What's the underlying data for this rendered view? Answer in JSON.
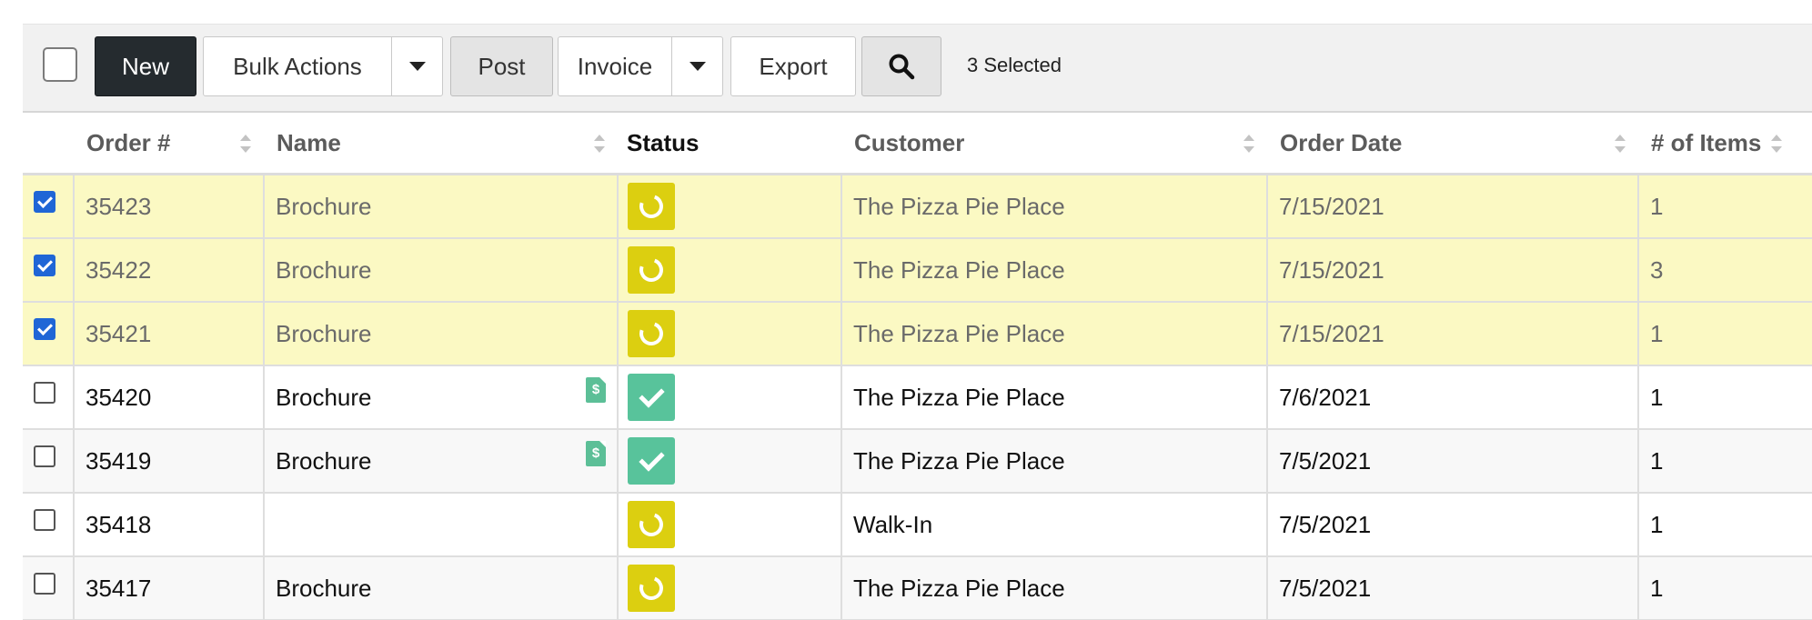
{
  "toolbar": {
    "new_label": "New",
    "bulk_actions_label": "Bulk Actions",
    "post_label": "Post",
    "invoice_label": "Invoice",
    "export_label": "Export",
    "selected_text": "3 Selected"
  },
  "table": {
    "columns": [
      "Order #",
      "Name",
      "Status",
      "Customer",
      "Order Date",
      "# of Items"
    ],
    "rows": [
      {
        "checked": true,
        "order": "35423",
        "name": "Brochure",
        "has_invoice": false,
        "status": "pending",
        "customer": "The Pizza Pie Place",
        "date": "7/15/2021",
        "items": "1"
      },
      {
        "checked": true,
        "order": "35422",
        "name": "Brochure",
        "has_invoice": false,
        "status": "pending",
        "customer": "The Pizza Pie Place",
        "date": "7/15/2021",
        "items": "3"
      },
      {
        "checked": true,
        "order": "35421",
        "name": "Brochure",
        "has_invoice": false,
        "status": "pending",
        "customer": "The Pizza Pie Place",
        "date": "7/15/2021",
        "items": "1"
      },
      {
        "checked": false,
        "order": "35420",
        "name": "Brochure",
        "has_invoice": true,
        "status": "complete",
        "customer": "The Pizza Pie Place",
        "date": "7/6/2021",
        "items": "1"
      },
      {
        "checked": false,
        "order": "35419",
        "name": "Brochure",
        "has_invoice": true,
        "status": "complete",
        "customer": "The Pizza Pie Place",
        "date": "7/5/2021",
        "items": "1"
      },
      {
        "checked": false,
        "order": "35418",
        "name": "",
        "has_invoice": false,
        "status": "pending",
        "customer": "Walk-In",
        "date": "7/5/2021",
        "items": "1"
      },
      {
        "checked": false,
        "order": "35417",
        "name": "Brochure",
        "has_invoice": false,
        "status": "pending",
        "customer": "The Pizza Pie Place",
        "date": "7/5/2021",
        "items": "1"
      }
    ]
  },
  "icons": {
    "status_pending": "circle-pending-icon",
    "status_complete": "check-icon",
    "invoice": "invoice-dollar-icon",
    "search": "search-icon"
  },
  "colors": {
    "selected_row": "#fbf9c3",
    "pending": "#dccf10",
    "complete": "#58c39b",
    "primary_button": "#252b2f"
  }
}
